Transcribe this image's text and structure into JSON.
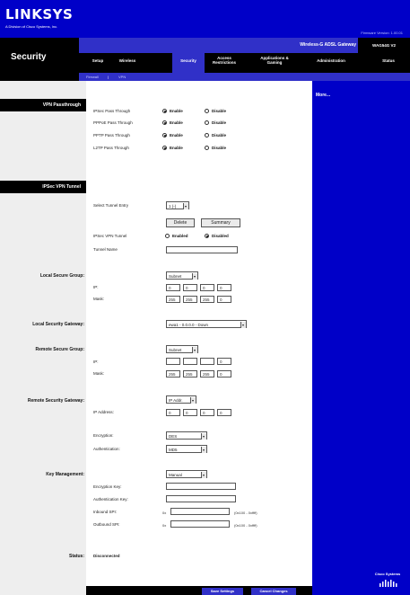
{
  "header": {
    "logo": "LINKSYS",
    "logo_sub": "A Division of Cisco Systems, Inc.",
    "firmware_version": "Firmware Version: 1.00.01",
    "product_name": "Wireless-G ADSL Gateway",
    "model_number": "WAG54G V2",
    "section_title": "Security"
  },
  "nav": {
    "tabs": [
      {
        "label": "Setup"
      },
      {
        "label": "Wireless"
      },
      {
        "label": "Security"
      },
      {
        "label": "Access Restrictions"
      },
      {
        "label": "Applications & Gaming"
      },
      {
        "label": "Administration"
      },
      {
        "label": "Status"
      }
    ],
    "subtabs": [
      {
        "label": "Firewall"
      },
      {
        "label": "VPN"
      }
    ]
  },
  "sidebar": {
    "more_link": "More...",
    "cisco_logo": "Cisco Systems"
  },
  "vpn_passthrough": {
    "heading": "VPN Passthrough",
    "rows": [
      {
        "label": "IPSec Pass Through",
        "enable": "Enable",
        "disable": "Disable"
      },
      {
        "label": "PPPoE Pass Through",
        "enable": "Enable",
        "disable": "Disable"
      },
      {
        "label": "PPTP Pass Through",
        "enable": "Enable",
        "disable": "Disable"
      },
      {
        "label": "L2TP Pass Through",
        "enable": "Enable",
        "disable": "Disable"
      }
    ]
  },
  "ipsec_tunnel": {
    "heading": "IPSec VPN Tunnel",
    "select_entry_label": "Select Tunnel Entry",
    "select_entry_value": "1 (-)",
    "delete_label": "Delete",
    "summary_label": "Summary",
    "tunnel_label": "IPSec VPN Tunnel",
    "enabled": "Enabled",
    "disabled": "Disabled",
    "tunnel_name_label": "Tunnel Name",
    "tunnel_name_value": ""
  },
  "local_group": {
    "label": "Local Secure Group:",
    "type": "Subnet",
    "ip_label": "IP:",
    "ip": [
      "0",
      "0",
      "0",
      "0"
    ],
    "mask_label": "Mask:",
    "mask": [
      "255",
      "255",
      "255",
      "0"
    ]
  },
  "local_gateway": {
    "label": "Local Security Gateway:",
    "value": "ewa1 - 0.0.0.0 - Down"
  },
  "remote_group": {
    "label": "Remote Secure Group:",
    "type": "Subnet",
    "ip_label": "IP:",
    "ip": [
      "",
      "",
      "",
      "0"
    ],
    "mask_label": "Mask:",
    "mask": [
      "255",
      "255",
      "255",
      "0"
    ]
  },
  "remote_gateway": {
    "label": "Remote Security Gateway:",
    "type": "IP Addr.",
    "ip_label": "IP Address:",
    "ip": [
      "0",
      "0",
      "0",
      "0"
    ]
  },
  "encryption": {
    "encryption_label": "Encryption:",
    "encryption_value": "DES",
    "auth_label": "Authentication:",
    "auth_value": "MD5"
  },
  "key_management": {
    "label": "Key Management:",
    "mode": "Manual",
    "encryption_key_label": "Encryption Key:",
    "auth_key_label": "Authentication Key:",
    "inbound_spi_label": "Inbound SPI:",
    "outbound_spi_label": "Outbound SPI:",
    "spi_prefix": "0x",
    "spi_range": "(0x100 - 0xffff)"
  },
  "status": {
    "label": "Status:",
    "value": "Disconnected"
  },
  "footer": {
    "save": "Save Settings",
    "cancel": "Cancel Changes"
  },
  "colors": {
    "brand_blue": "#0000c8",
    "nav_black": "#000000"
  }
}
